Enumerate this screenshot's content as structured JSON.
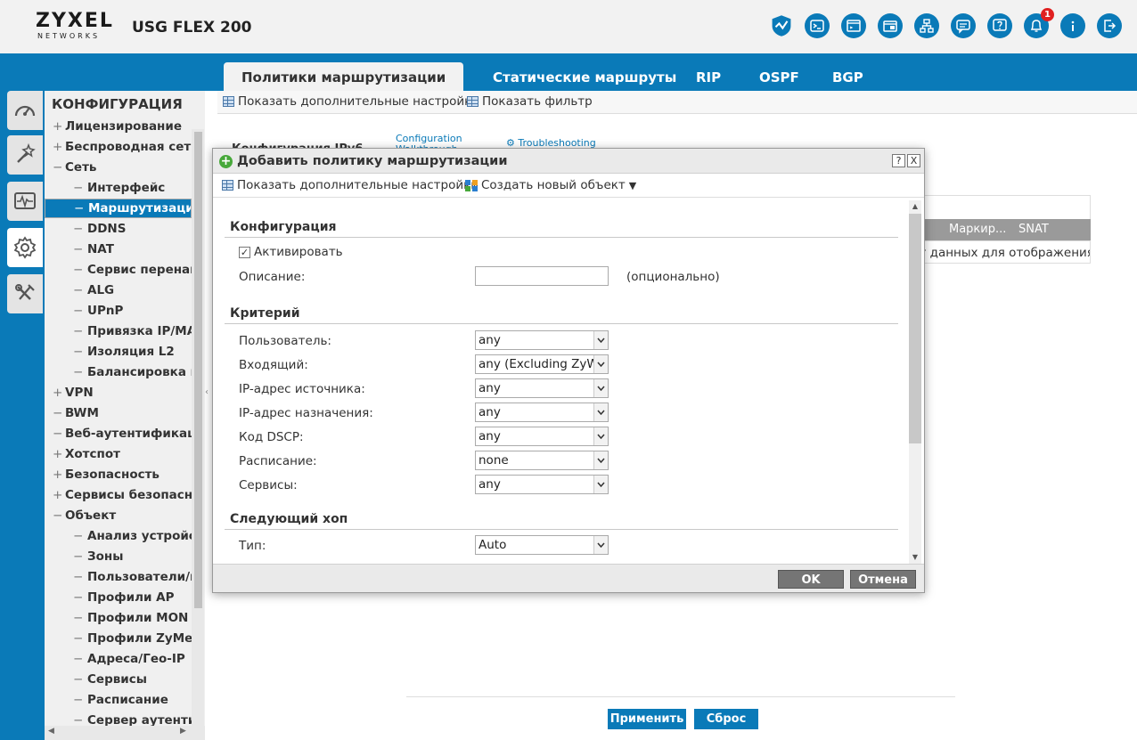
{
  "header": {
    "brand": "ZYXEL",
    "brand_sub": "NETWORKS",
    "model": "USG FLEX 200",
    "icons": [
      "shield-icon",
      "cli-icon",
      "console-icon",
      "window-icon",
      "sitemap-icon",
      "chat-icon",
      "help-icon",
      "bell-icon",
      "info-icon",
      "logout-icon"
    ],
    "notification_count": "1",
    "accent_color": "#0a7ab8"
  },
  "tabs": [
    {
      "label": "Политики маршрутизации",
      "active": true
    },
    {
      "label": "Статические маршруты"
    },
    {
      "label": "RIP"
    },
    {
      "label": "OSPF"
    },
    {
      "label": "BGP"
    }
  ],
  "left_icons": [
    "dashboard-icon",
    "wizard-icon",
    "monitor-icon",
    "gear-icon",
    "tools-icon"
  ],
  "sidebar": {
    "title": "КОНФИГУРАЦИЯ",
    "items": [
      {
        "mark": "+",
        "label": "Лицензирование"
      },
      {
        "mark": "+",
        "label": "Беспроводная сеть"
      },
      {
        "mark": "−",
        "label": "Сеть"
      },
      {
        "mark": "−",
        "label": "Интерфейс"
      },
      {
        "mark": "−",
        "label": "Маршрутизация"
      },
      {
        "mark": "−",
        "label": "DDNS"
      },
      {
        "mark": "−",
        "label": "NAT"
      },
      {
        "mark": "−",
        "label": "Сервис перенаправления"
      },
      {
        "mark": "−",
        "label": "ALG"
      },
      {
        "mark": "−",
        "label": "UPnP"
      },
      {
        "mark": "−",
        "label": "Привязка IP/MAC"
      },
      {
        "mark": "−",
        "label": "Изоляция L2"
      },
      {
        "mark": "−",
        "label": "Балансировка нагрузки"
      },
      {
        "mark": "+",
        "label": "VPN"
      },
      {
        "mark": "−",
        "label": "BWM"
      },
      {
        "mark": "−",
        "label": "Веб-аутентификация"
      },
      {
        "mark": "+",
        "label": "Хотспот"
      },
      {
        "mark": "+",
        "label": "Безопасность"
      },
      {
        "mark": "+",
        "label": "Сервисы безопасности"
      },
      {
        "mark": "−",
        "label": "Объект"
      },
      {
        "mark": "−",
        "label": "Анализ устройств"
      },
      {
        "mark": "−",
        "label": "Зоны"
      },
      {
        "mark": "−",
        "label": "Пользователи/группы"
      },
      {
        "mark": "−",
        "label": "Профили AP"
      },
      {
        "mark": "−",
        "label": "Профили MON"
      },
      {
        "mark": "−",
        "label": "Профили ZyMesh"
      },
      {
        "mark": "−",
        "label": "Адреса/Гео-IP"
      },
      {
        "mark": "−",
        "label": "Сервисы"
      },
      {
        "mark": "−",
        "label": "Расписание"
      },
      {
        "mark": "−",
        "label": "Сервер аутентификации"
      }
    ]
  },
  "main": {
    "toolbar_show_advanced": "Показать дополнительные настройки",
    "toolbar_show_filter": "Показать фильтр",
    "bg_ipv6": "Конфигурация IPv6",
    "bg_walkthrough_1": "Configuration",
    "bg_walkthrough_2": "Walkthrough",
    "bg_troubleshooting": "Troubleshooting",
    "bg_col_1": "...",
    "bg_col_2": "Маркир...",
    "bg_col_3": "SNAT",
    "bg_empty": "Нет данных для отображения",
    "apply": "Применить",
    "reset": "Сброс"
  },
  "modal": {
    "title": "Добавить политику маршрутизации",
    "help_btn": "?",
    "close_btn": "X",
    "toolbar_show_advanced": "Показать дополнительные настройки",
    "toolbar_new_object": "Создать новый объект",
    "section_config": "Конфигурация",
    "activate_label": "Активировать",
    "activate_checked": true,
    "description_label": "Описание:",
    "description_value": "",
    "description_hint": "(опционально)",
    "section_criteria": "Критерий",
    "fields": [
      {
        "label": "Пользователь:",
        "value": "any"
      },
      {
        "label": "Входящий:",
        "value": "any (Excluding ZyWALL)"
      },
      {
        "label": "IP-адрес источника:",
        "value": "any"
      },
      {
        "label": "IP-адрес назначения:",
        "value": "any"
      },
      {
        "label": "Код DSCP:",
        "value": "any"
      },
      {
        "label": "Расписание:",
        "value": "none"
      },
      {
        "label": "Сервисы:",
        "value": "any"
      }
    ],
    "section_nexthop": "Следующий хоп",
    "type_label": "Тип:",
    "type_value": "Auto",
    "ok": "OK",
    "cancel": "Отмена"
  }
}
